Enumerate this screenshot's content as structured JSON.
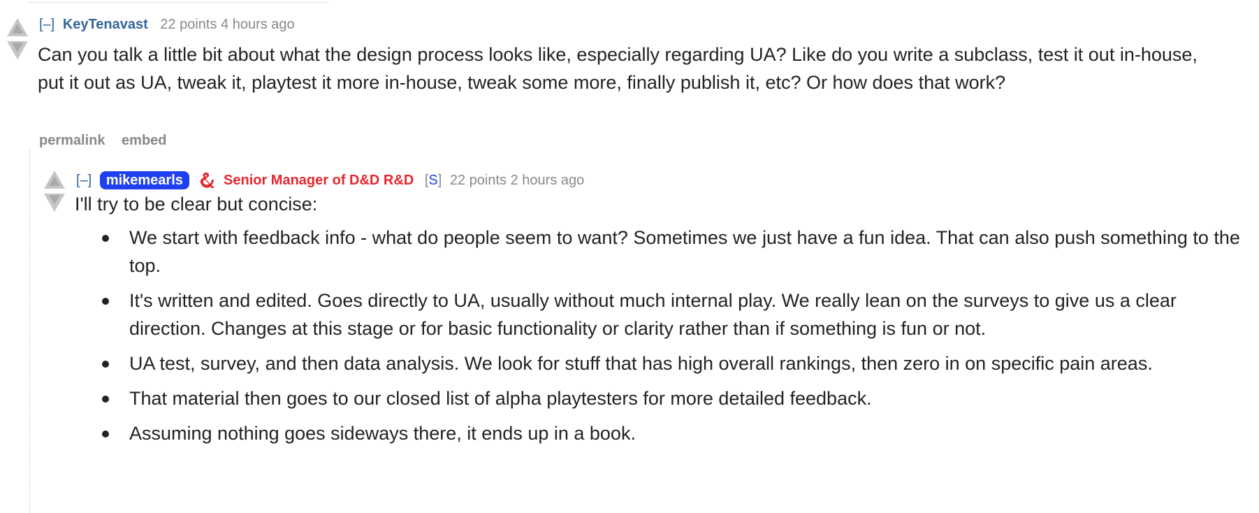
{
  "parent_comment": {
    "expand_label": "[–]",
    "author": "KeyTenavast",
    "score": "22 points",
    "age": "4 hours ago",
    "body": "Can you talk a little bit about what the design process looks like, especially regarding UA? Like do you write a subclass, test it out in-house, put it out as UA, tweak it, playtest it more in-house, tweak some more, finally publish it, etc? Or how does that work?",
    "actions": {
      "permalink": "permalink",
      "embed": "embed"
    }
  },
  "reply_comment": {
    "expand_label": "[–]",
    "author": "mikemearls",
    "flair_icon": "dnd-ampersand-icon",
    "flair": "Senior Manager of D&D R&D",
    "submitter_open": "[",
    "submitter_tag": "S",
    "submitter_close": "]",
    "score": "22 points",
    "age": "2 hours ago",
    "intro": "I'll try to be clear but concise:",
    "bullets": [
      "We start with feedback info - what do people seem to want? Sometimes we just have a fun idea. That can also push something to the top.",
      "It's written and edited. Goes directly to UA, usually without much internal play. We really lean on the surveys to give us a clear direction. Changes at this stage or for basic functionality or clarity rather than if something is fun or not.",
      "UA test, survey, and then data analysis. We look for stuff that has high overall rankings, then zero in on specific pain areas.",
      "That material then goes to our closed list of alpha playtesters for more detailed feedback.",
      "Assuming nothing goes sideways there, it ends up in a book."
    ]
  },
  "colors": {
    "author_link": "#336699",
    "meta_gray": "#888888",
    "admin_badge_bg": "#1f40f0",
    "flair_red": "#e4272e",
    "body_text": "#222222"
  }
}
